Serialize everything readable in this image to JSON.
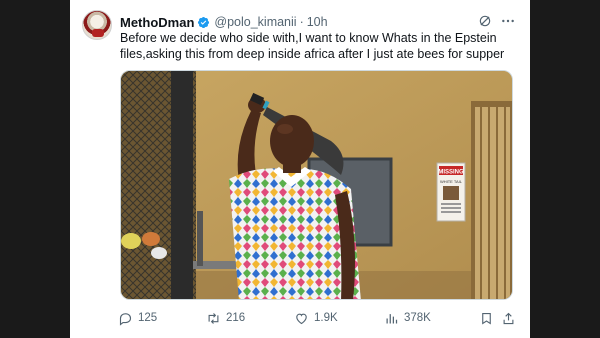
{
  "post": {
    "display_name": "MethoDman",
    "handle": "@polo_kimanii",
    "separator": "·",
    "time": "10h",
    "text": "Before we decide who side with,I want to know Whats in the Epstein files,asking this from deep inside africa after I just ate bees for supper",
    "verified": true
  },
  "media": {
    "poster_text_1": "MISSING",
    "poster_text_2": "WHITE TAIL"
  },
  "actions": {
    "replies": "125",
    "reposts": "216",
    "likes": "1.9K",
    "views": "378K"
  },
  "colors": {
    "verified": "#1d9bf0",
    "muted_text": "#536471",
    "text": "#0f1419",
    "background": "#1a1a1a"
  },
  "icons": [
    "verified-badge-icon",
    "grok-icon",
    "more-icon",
    "reply-icon",
    "repost-icon",
    "like-icon",
    "views-icon",
    "bookmark-icon",
    "share-icon"
  ]
}
